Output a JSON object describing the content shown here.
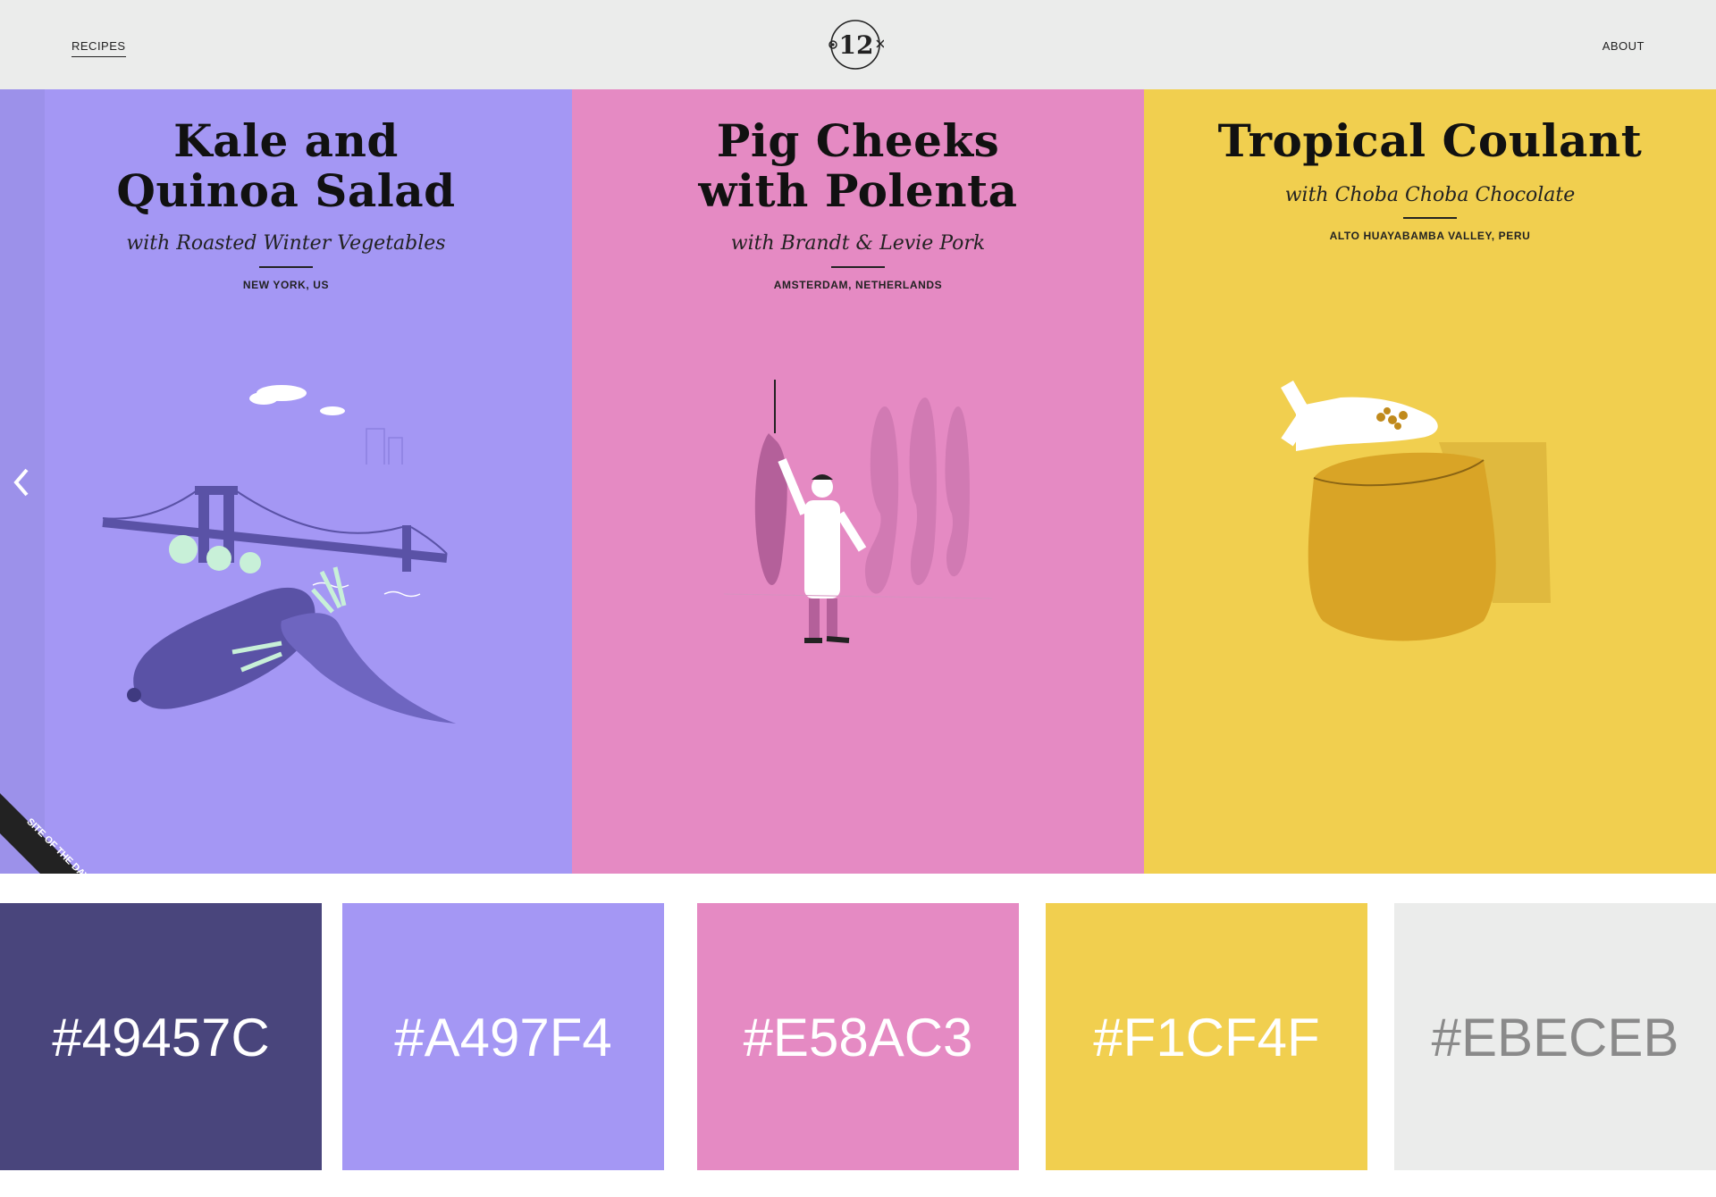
{
  "header": {
    "left_link": "RECIPES",
    "right_link": "ABOUT",
    "logo_text": "12"
  },
  "panels": [
    {
      "title_line1": "Kale and",
      "title_line2": "Quinoa Salad",
      "subtitle": "with Roasted Winter Vegetables",
      "place": "NEW YORK, US",
      "bg": "#A497F4"
    },
    {
      "title_line1": "Pig Cheeks",
      "title_line2": "with Polenta",
      "subtitle": "with Brandt & Levie Pork",
      "place": "AMSTERDAM, NETHERLANDS",
      "bg": "#E58AC3"
    },
    {
      "title_line1": "Tropical Coulant",
      "subtitle": "with Choba Choba Chocolate",
      "place": "ALTO HUAYABAMBA VALLEY, PERU",
      "bg": "#F1CF4F"
    }
  ],
  "ribbon_text": "SITE OF THE DAY",
  "swatches": [
    {
      "label": "#49457C",
      "color": "#49457C",
      "text_color": "#ffffff"
    },
    {
      "label": "#A497F4",
      "color": "#A497F4",
      "text_color": "#ffffff"
    },
    {
      "label": "#E58AC3",
      "color": "#E58AC3",
      "text_color": "#ffffff"
    },
    {
      "label": "#F1CF4F",
      "color": "#F1CF4F",
      "text_color": "#ffffff"
    },
    {
      "label": "#EBECEB",
      "color": "#EBECEB",
      "text_color": "#8a8a8a"
    }
  ]
}
